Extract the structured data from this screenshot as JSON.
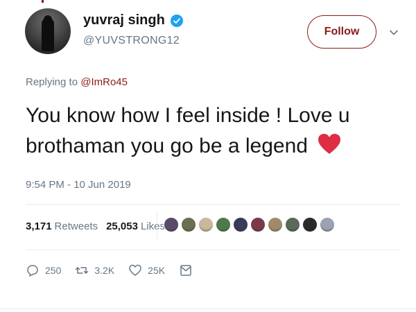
{
  "user": {
    "display_name": "yuvraj singh",
    "handle": "@YUVSTRONG12",
    "verified_icon": "verified-badge-icon"
  },
  "header": {
    "follow_label": "Follow",
    "accent_color": "#8a1a1a"
  },
  "tweet": {
    "replying_prefix": "Replying to",
    "replying_to": "@ImRo45",
    "text": "You know how I feel inside ! Love u brothaman you go be a legend",
    "emoji": "heart-icon",
    "timestamp": "9:54 PM - 10 Jun 2019"
  },
  "stats": {
    "retweets_count": "3,171",
    "retweets_label": "Retweets",
    "likes_count": "25,053",
    "likes_label": "Likes",
    "liker_avatar_colors": [
      "#5a4a6a",
      "#6a7050",
      "#c9b89a",
      "#4e7a4a",
      "#3a3a5a",
      "#7a3a4a",
      "#a08a6a",
      "#5a6a5a",
      "#2a2a2a",
      "#9aa4b0"
    ]
  },
  "actions": {
    "reply_count": "250",
    "retweet_count": "3.2K",
    "like_count": "25K",
    "reply_icon": "reply-icon",
    "retweet_icon": "retweet-icon",
    "like_icon": "like-icon",
    "dm_icon": "direct-message-icon"
  }
}
